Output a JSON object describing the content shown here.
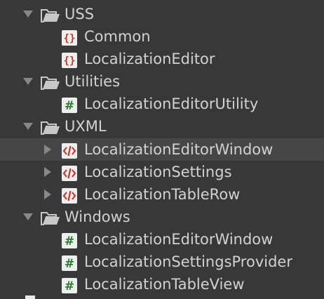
{
  "tree": {
    "top_partial_label": "",
    "rows": [
      {
        "label": "USS",
        "icon": "folder-open-icon",
        "expanded": true,
        "has_arrow": true
      },
      {
        "label": "Common",
        "icon": "uss-file-icon",
        "has_arrow": false
      },
      {
        "label": "LocalizationEditor",
        "icon": "uss-file-icon",
        "has_arrow": false
      },
      {
        "label": "Utilities",
        "icon": "folder-open-icon",
        "expanded": true,
        "has_arrow": true
      },
      {
        "label": "LocalizationEditorUtility",
        "icon": "csharp-script-icon",
        "has_arrow": false
      },
      {
        "label": "UXML",
        "icon": "folder-open-icon",
        "expanded": true,
        "has_arrow": true
      },
      {
        "label": "LocalizationEditorWindow",
        "icon": "uxml-file-icon",
        "expanded": false,
        "has_arrow": true,
        "selected": true
      },
      {
        "label": "LocalizationSettings",
        "icon": "uxml-file-icon",
        "expanded": false,
        "has_arrow": true
      },
      {
        "label": "LocalizationTableRow",
        "icon": "uxml-file-icon",
        "expanded": false,
        "has_arrow": true
      },
      {
        "label": "Windows",
        "icon": "folder-open-icon",
        "expanded": true,
        "has_arrow": true
      },
      {
        "label": "LocalizationEditorWindow",
        "icon": "csharp-script-icon",
        "has_arrow": false
      },
      {
        "label": "LocalizationSettingsProvider",
        "icon": "csharp-script-icon",
        "has_arrow": false
      },
      {
        "label": "LocalizationTableView",
        "icon": "csharp-script-icon",
        "has_arrow": false
      }
    ]
  },
  "colors": {
    "background": "#383838",
    "selected_row": "#464646",
    "text": "#d2d2d2",
    "arrow": "#888888",
    "folder": "#c8c8c8",
    "file_icon_bg": "#eeeeee",
    "uss_red": "#c0392b",
    "csharp_green": "#2e7d32"
  }
}
